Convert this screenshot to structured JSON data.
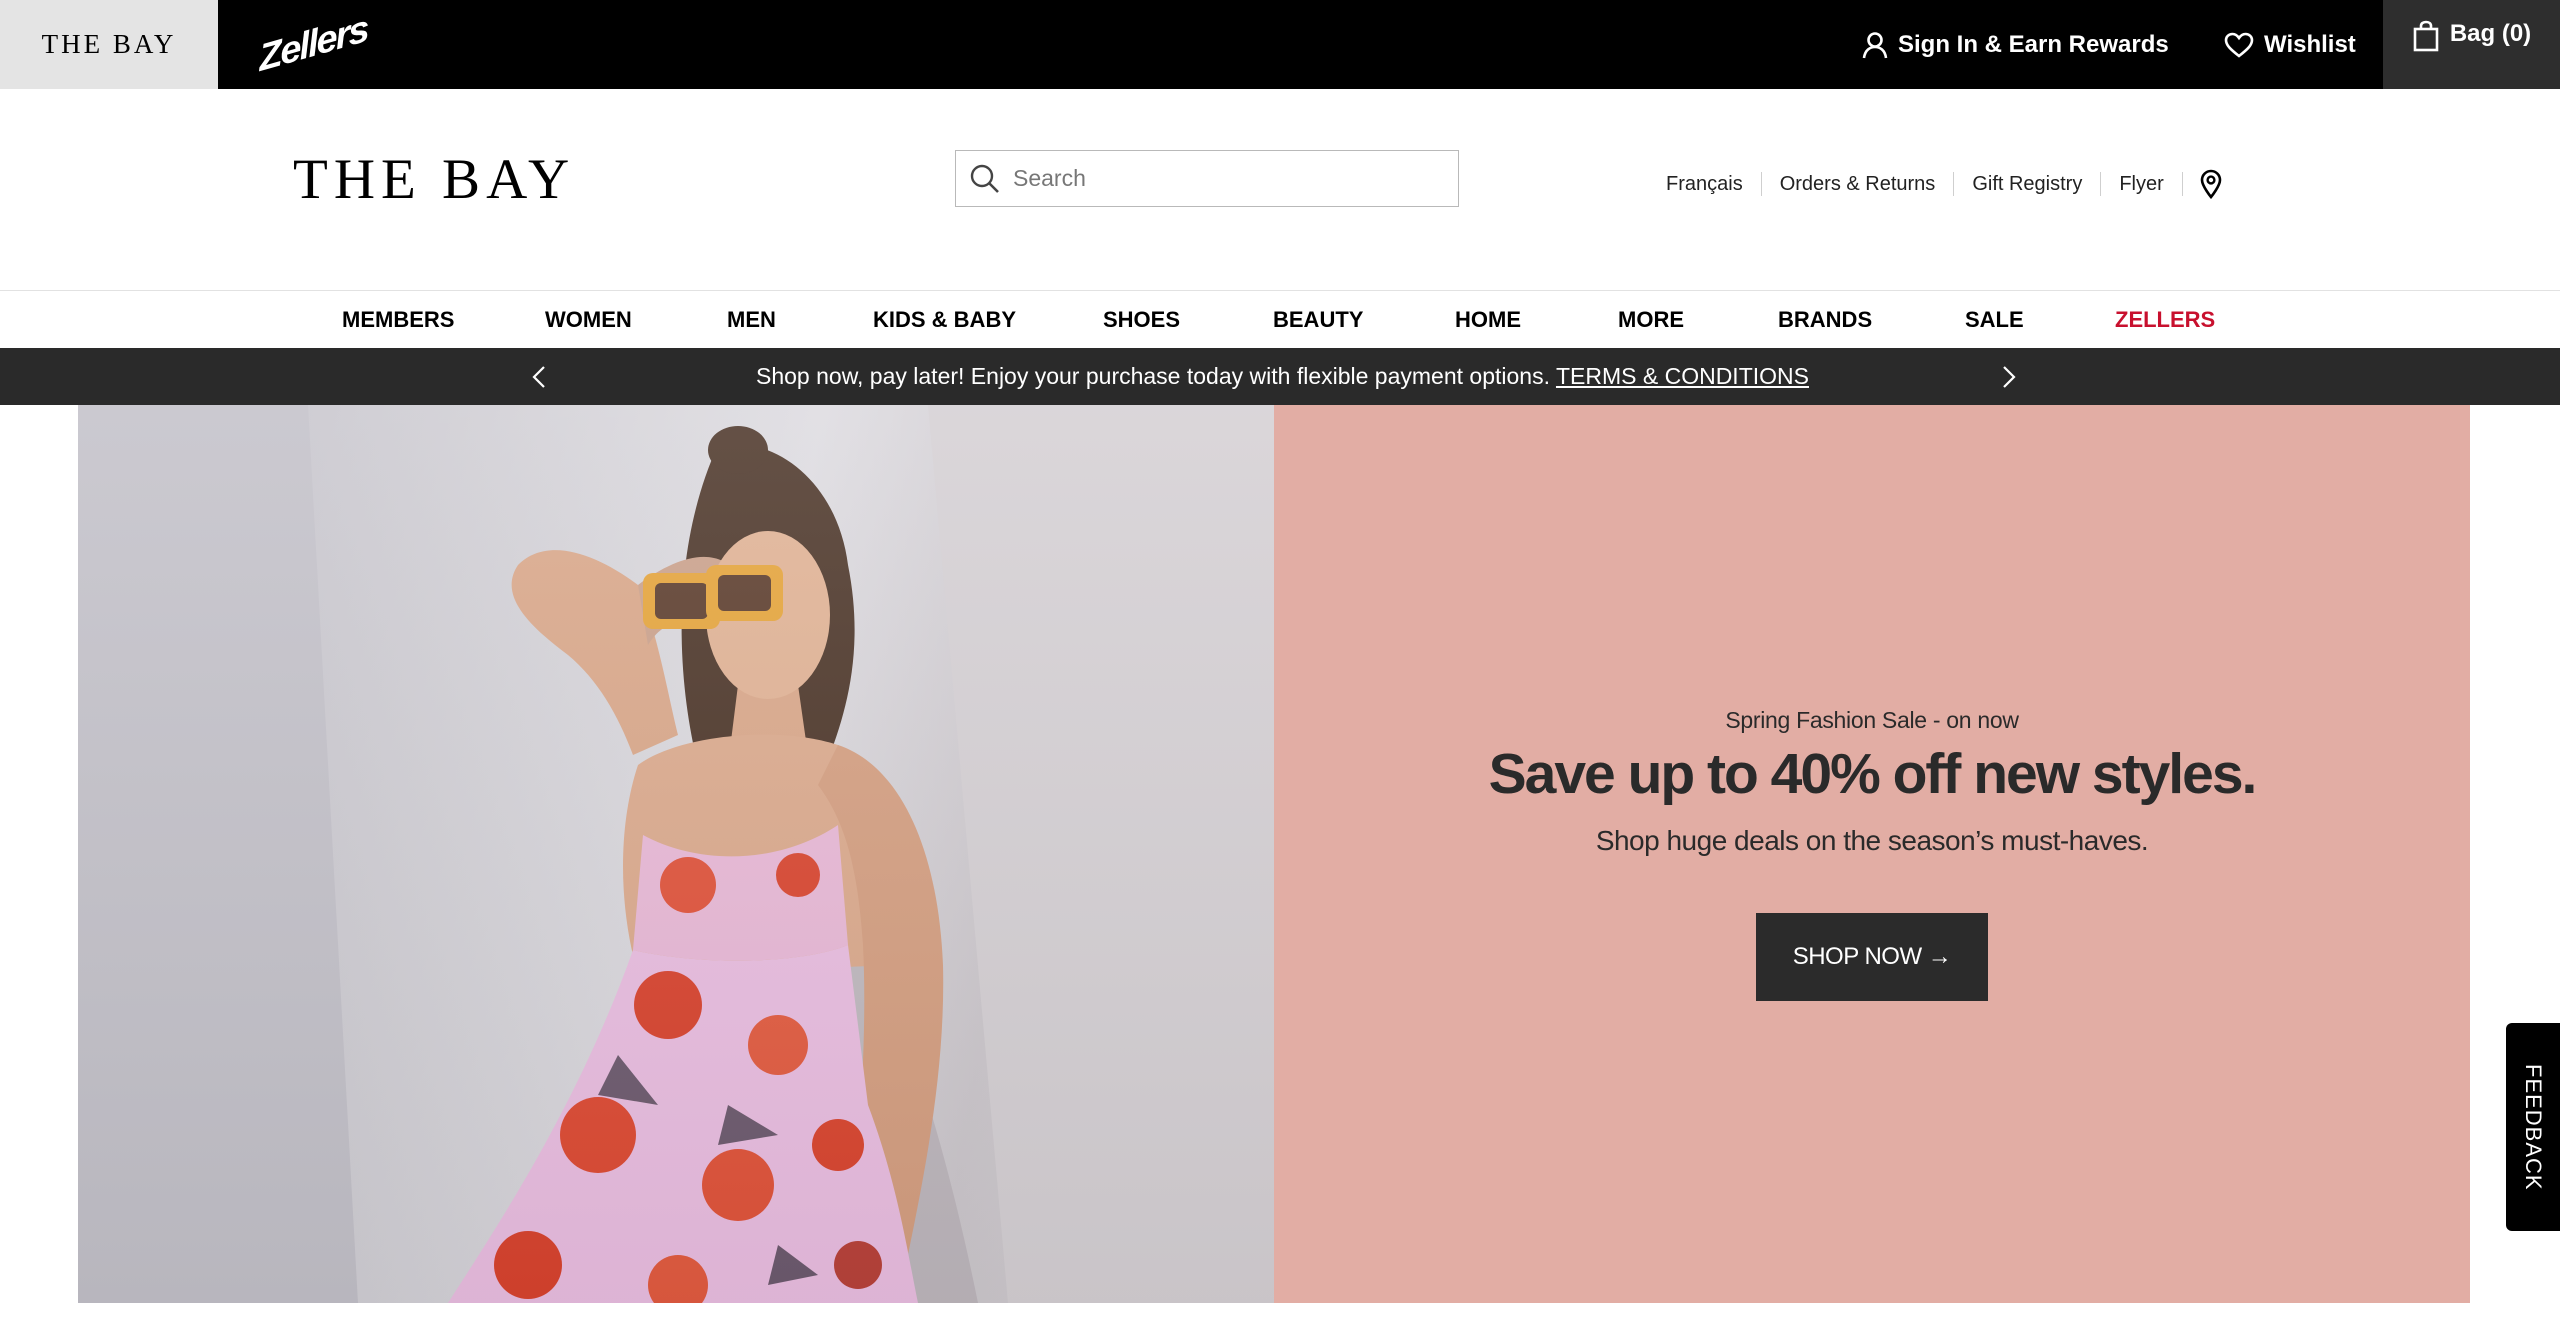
{
  "top_bar": {
    "brand_tabs": [
      "THE BAY",
      "Zellers"
    ],
    "sign_in": "Sign In & Earn Rewards",
    "wishlist": "Wishlist",
    "bag": "Bag (0)"
  },
  "header": {
    "logo": "THE BAY",
    "search_placeholder": "Search",
    "links": [
      "Français",
      "Orders & Returns",
      "Gift Registry",
      "Flyer"
    ]
  },
  "nav": {
    "items": [
      "MEMBERS",
      "WOMEN",
      "MEN",
      "KIDS & BABY",
      "SHOES",
      "BEAUTY",
      "HOME",
      "MORE",
      "BRANDS",
      "SALE",
      "ZELLERS"
    ]
  },
  "promo_bar": {
    "text": "Shop now, pay later! Enjoy your purchase today with flexible payment options.",
    "link": "TERMS & CONDITIONS"
  },
  "hero": {
    "eyebrow": "Spring Fashion Sale - on now",
    "headline": "Save up to 40% off new styles.",
    "subline": "Shop huge deals on the season’s must-haves.",
    "cta": "SHOP NOW →",
    "panel_color": "#e2ada4"
  },
  "feedback_tab": "FEEDBACK",
  "colors": {
    "top_bar": "#000000",
    "promo_bar": "#2a2a2a",
    "zellers_red": "#c8102e",
    "button": "#2b2b2b"
  }
}
